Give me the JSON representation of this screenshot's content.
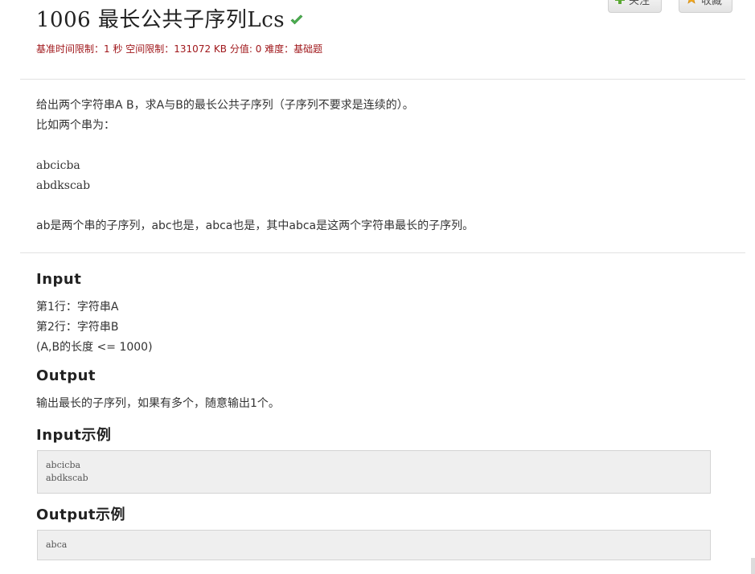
{
  "header": {
    "title": "1006 最长公共子序列Lcs",
    "follow_label": "关注",
    "collect_label": "收藏",
    "meta": {
      "time_limit": "基准时间限制：1 秒",
      "memory_limit": "空间限制：131072 KB",
      "score": "分值: 0",
      "difficulty": "难度：基础题"
    }
  },
  "description": {
    "lines": [
      "给出两个字符串A B，求A与B的最长公共子序列（子序列不要求是连续的）。",
      "比如两个串为：",
      "",
      "abcicba",
      "abdkscab",
      "",
      "ab是两个串的子序列，abc也是，abca也是，其中abca是这两个字符串最长的子序列。"
    ]
  },
  "input_section": {
    "heading": "Input",
    "lines": [
      "第1行：字符串A",
      "第2行：字符串B",
      "(A,B的长度 <= 1000)"
    ]
  },
  "output_section": {
    "heading": "Output",
    "lines": [
      "输出最长的子序列，如果有多个，随意输出1个。"
    ]
  },
  "input_example": {
    "heading": "Input示例",
    "lines": [
      "abcicba",
      "abdkscab"
    ]
  },
  "output_example": {
    "heading": "Output示例",
    "lines": [
      "abca"
    ]
  },
  "colors": {
    "meta_red": "#a0181c",
    "check_green": "#4caf50",
    "code_bg": "#efefef"
  },
  "icons": {
    "solved": "check-icon",
    "follow": "plus-icon",
    "collect": "star-icon"
  }
}
